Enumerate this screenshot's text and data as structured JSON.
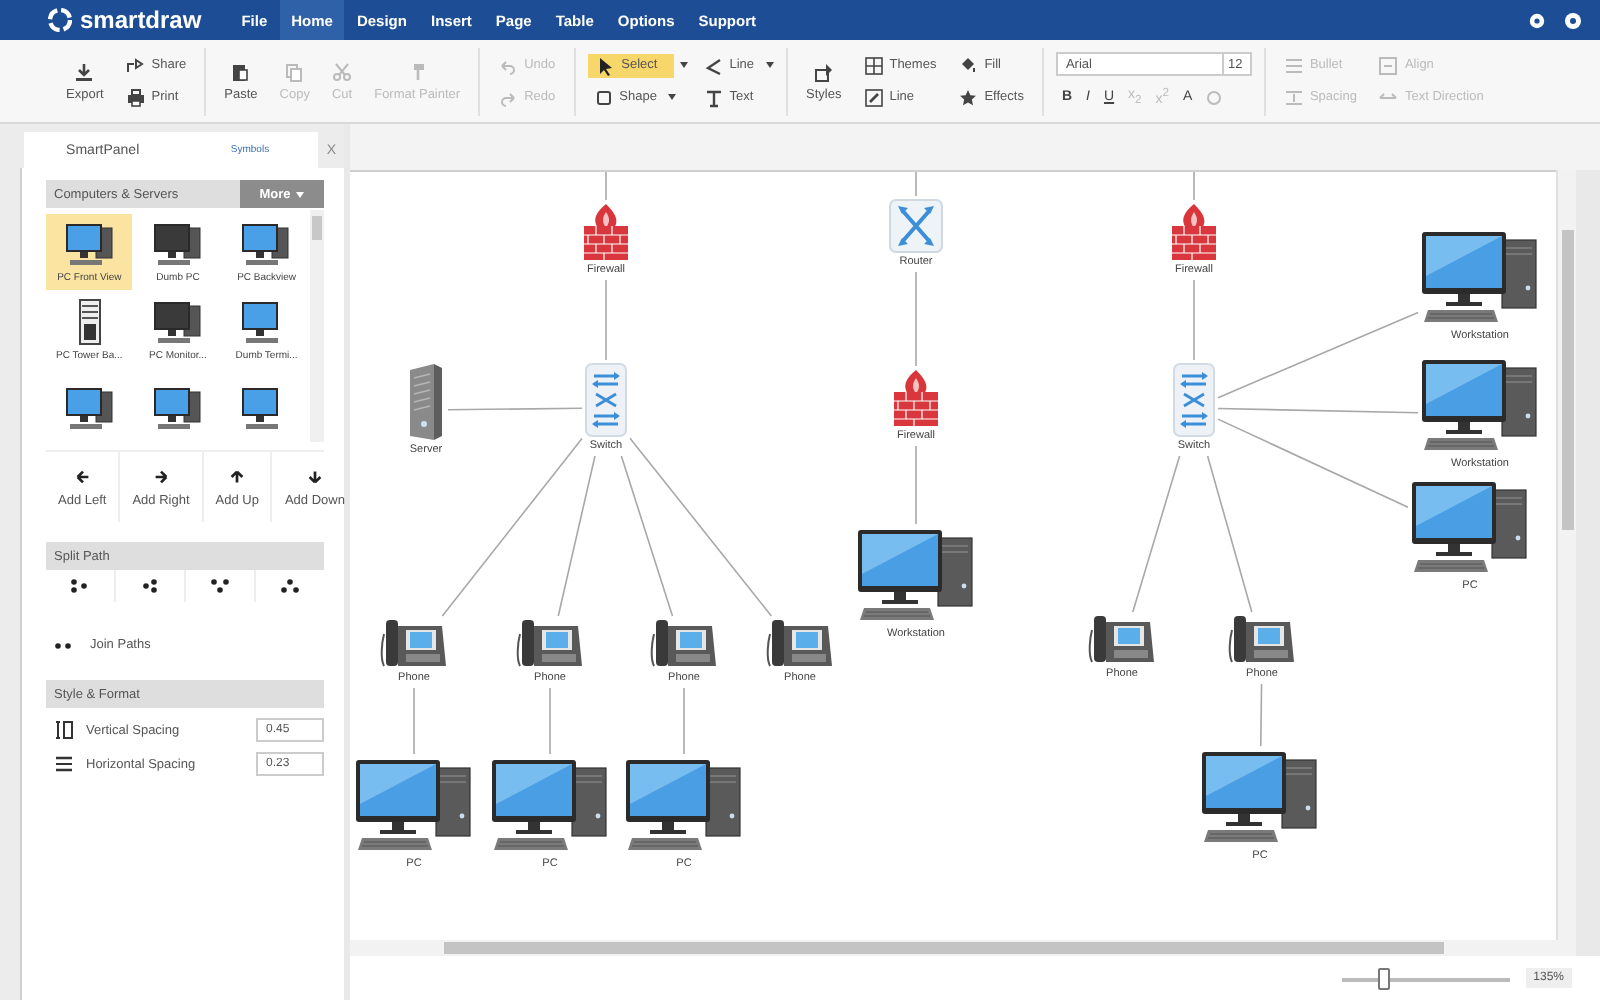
{
  "menu_bar": {
    "logo": "smartdraw",
    "items": [
      {
        "label": "File",
        "selected": false
      },
      {
        "label": "Home",
        "selected": true
      },
      {
        "label": "Design",
        "selected": false
      },
      {
        "label": "Insert",
        "selected": false
      },
      {
        "label": "Page",
        "selected": false
      },
      {
        "label": "Table",
        "selected": false
      },
      {
        "label": "Options",
        "selected": false
      },
      {
        "label": "Support",
        "selected": false
      }
    ]
  },
  "toolbar": {
    "groups": [
      {
        "buttons": [
          {
            "label": "Export",
            "kind": "large",
            "disabled": false
          },
          {
            "label": "Share",
            "kind": "small",
            "disabled": false
          },
          {
            "label": "Print",
            "kind": "small",
            "disabled": false
          }
        ]
      },
      {
        "buttons": [
          {
            "label": "Paste",
            "kind": "large",
            "disabled": false
          },
          {
            "label": "Copy",
            "kind": "large",
            "disabled": true
          },
          {
            "label": "Cut",
            "kind": "large",
            "disabled": true
          },
          {
            "label": "Format Painter",
            "kind": "large",
            "disabled": true
          }
        ]
      },
      {
        "buttons": [
          {
            "label": "Undo",
            "kind": "small",
            "disabled": true
          },
          {
            "label": "Redo",
            "kind": "small",
            "disabled": true
          }
        ]
      },
      {
        "buttons": [
          {
            "label": "Select",
            "kind": "small",
            "disabled": false,
            "selected": true,
            "dropdown": true
          },
          {
            "label": "Shape",
            "kind": "small",
            "disabled": false,
            "selected": false,
            "dropdown": true
          },
          {
            "label": "Line",
            "kind": "small",
            "disabled": false,
            "selected": false,
            "dropdown": true
          },
          {
            "label": "Text",
            "kind": "small",
            "disabled": false,
            "selected": false,
            "dropdown": false
          }
        ]
      },
      {
        "buttons": [
          {
            "label": "Styles",
            "kind": "large",
            "disabled": false
          },
          {
            "label": "Themes",
            "kind": "small",
            "disabled": false
          },
          {
            "label": "Line",
            "kind": "small",
            "disabled": false
          },
          {
            "label": "Fill",
            "kind": "small",
            "disabled": false
          },
          {
            "label": "Effects",
            "kind": "small",
            "disabled": false
          }
        ]
      },
      {
        "font": {
          "name": "Arial",
          "size": "12",
          "formats": [
            {
              "label": "B",
              "disabled": false
            },
            {
              "label": "I",
              "disabled": false
            },
            {
              "label": "U",
              "disabled": false
            },
            {
              "label": "x$_{2}$",
              "disabled": true
            },
            {
              "label": "x$^{2}$",
              "disabled": true
            },
            {
              "label": "A",
              "disabled": false
            }
          ]
        }
      },
      {
        "buttons": [
          {
            "label": "Bullet",
            "kind": "small",
            "disabled": true
          },
          {
            "label": "Spacing",
            "kind": "small",
            "disabled": true
          },
          {
            "label": "Align",
            "kind": "small",
            "disabled": true
          },
          {
            "label": "Text Direction",
            "kind": "small",
            "disabled": true
          }
        ]
      }
    ]
  },
  "side_panel": {
    "tabs": [
      {
        "label": "SmartPanel",
        "selected": true
      },
      {
        "label": "Symbols",
        "selected": false
      }
    ],
    "close": "X",
    "library": {
      "title": "Computers & Servers",
      "more_button": "More",
      "symbols": [
        {
          "label": "PC Front View",
          "selected": true
        },
        {
          "label": "Dumb PC",
          "selected": false
        },
        {
          "label": "PC Backview",
          "selected": false
        },
        {
          "label": "PC Tower Ba...",
          "selected": false
        },
        {
          "label": "PC Monitor...",
          "selected": false
        },
        {
          "label": "Dumb Termi...",
          "selected": false
        },
        {
          "selected": false
        },
        {
          "selected": false
        },
        {
          "selected": false
        }
      ]
    },
    "add_buttons": [
      "Add Left",
      "Add Right",
      "Add Up",
      "Add Down"
    ],
    "split_path": {
      "title": "Split Path"
    },
    "join_paths": "Join Paths",
    "style_format": {
      "title": "Style & Format",
      "fields": [
        {
          "label": "Vertical Spacing",
          "value": "0.45"
        },
        {
          "label": "Horizontal Spacing",
          "value": "0.23"
        }
      ]
    }
  },
  "canvas": {
    "nodes": [
      {
        "kind": "firewall",
        "label": "Firewall"
      },
      {
        "kind": "router",
        "label": "Router"
      },
      {
        "kind": "firewall",
        "label": "Firewall"
      },
      {
        "kind": "server",
        "label": "Server"
      },
      {
        "kind": "switch",
        "label": "Switch"
      },
      {
        "kind": "firewall",
        "label": "Firewall"
      },
      {
        "kind": "switch",
        "label": "Switch"
      },
      {
        "kind": "computer",
        "label": "Workstation"
      },
      {
        "kind": "computer",
        "label": "Workstation"
      },
      {
        "kind": "computer",
        "label": "Workstation"
      },
      {
        "kind": "computer",
        "label": "PC"
      },
      {
        "kind": "phone",
        "label": "Phone"
      },
      {
        "kind": "phone",
        "label": "Phone"
      },
      {
        "kind": "phone",
        "label": "Phone"
      },
      {
        "kind": "phone",
        "label": "Phone"
      },
      {
        "kind": "phone",
        "label": "Phone"
      },
      {
        "kind": "phone",
        "label": "Phone"
      },
      {
        "kind": "computer",
        "label": "PC"
      },
      {
        "kind": "computer",
        "label": "PC"
      },
      {
        "kind": "computer",
        "label": "PC"
      },
      {
        "kind": "computer",
        "label": "PC"
      }
    ]
  },
  "zoom": {
    "level": 0.25,
    "reading": "135%"
  }
}
